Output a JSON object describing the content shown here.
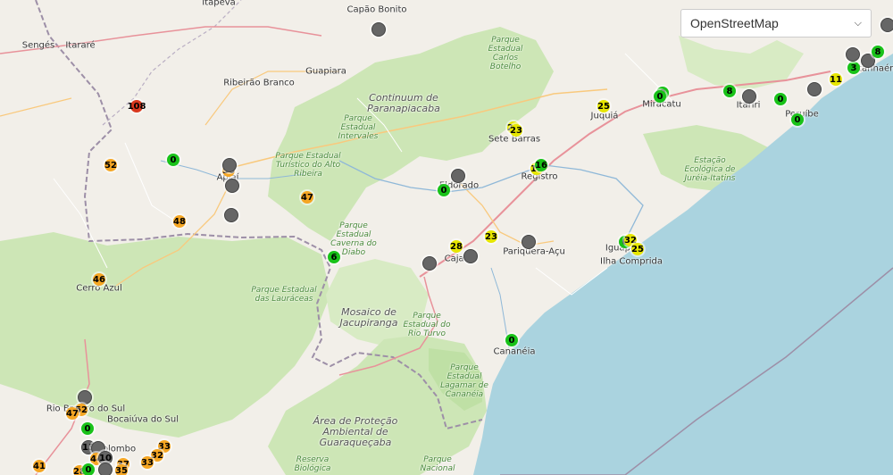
{
  "colors": {
    "green": "#19c219",
    "yellow": "#e6e600",
    "orange": "#f5a623",
    "red": "#d9381e",
    "gray": "#666666",
    "sea": "#aad3df",
    "forest": "#cde6b6"
  },
  "layer_select": {
    "value": "OpenStreetMap"
  },
  "places": [
    {
      "id": "itapeva",
      "label": "Itapeva"
    },
    {
      "id": "capao-bonito",
      "label": "Capão Bonito"
    },
    {
      "id": "senges",
      "label": "Sengés"
    },
    {
      "id": "itarare",
      "label": "Itararé"
    },
    {
      "id": "guapiara",
      "label": "Guapiara"
    },
    {
      "id": "ribeirao-branco",
      "label": "Ribeirão Branco"
    },
    {
      "id": "juquia",
      "label": "Juquiá"
    },
    {
      "id": "miracatu",
      "label": "Miracatu"
    },
    {
      "id": "itariri",
      "label": "Itariri"
    },
    {
      "id": "peruibe",
      "label": "Peruíbe"
    },
    {
      "id": "itanhaem",
      "label": "Itanhaém"
    },
    {
      "id": "sete-barras",
      "label": "Sete Barras"
    },
    {
      "id": "registro",
      "label": "Registro"
    },
    {
      "id": "eldorado",
      "label": "Eldorado"
    },
    {
      "id": "apiai",
      "label": "Apiaí"
    },
    {
      "id": "cajati",
      "label": "Cajati"
    },
    {
      "id": "pariquera-acu",
      "label": "Pariquera-Açu"
    },
    {
      "id": "iguape",
      "label": "Iguape"
    },
    {
      "id": "ilha-comprida",
      "label": "Ilha Comprida"
    },
    {
      "id": "cananeia",
      "label": "Cananéia"
    },
    {
      "id": "cerro-azul",
      "label": "Cerro Azul"
    },
    {
      "id": "rio-branco-do-sul",
      "label": "Rio Branco do Sul"
    },
    {
      "id": "bocaiuva-do-sul",
      "label": "Bocaiúva do Sul"
    },
    {
      "id": "colombo",
      "label": "Colombo"
    }
  ],
  "areas": [
    {
      "id": "parque-carlos-botelho",
      "label": "Parque Estadual Carlos Botelho"
    },
    {
      "id": "continuum",
      "label": "Continuum de Paranapiacaba"
    },
    {
      "id": "parque-intervales",
      "label": "Parque Estadual Intervales"
    },
    {
      "id": "parque-petar",
      "label": "Parque Estadual Turístico do Alto Ribeira"
    },
    {
      "id": "parque-caverna-do-diabo",
      "label": "Parque Estadual Caverna do Diabo"
    },
    {
      "id": "parque-lauraceas",
      "label": "Parque Estadual das Lauráceas"
    },
    {
      "id": "mosaico-jacupiranga",
      "label": "Mosaico de Jacupiranga"
    },
    {
      "id": "parque-rio-turvo",
      "label": "Parque Estadual do Rio Turvo"
    },
    {
      "id": "estacao-jureia",
      "label": "Estação Ecológica de Juréia-Itatins"
    },
    {
      "id": "parque-lagamar",
      "label": "Parque Estadual Lagamar de Cananéia"
    },
    {
      "id": "apa-guaraquecaba",
      "label": "Área de Proteção Ambiental de Guaraqueçaba"
    },
    {
      "id": "parque-nacional",
      "label": "Parque Nacional"
    },
    {
      "id": "reserva-biologica",
      "label": "Reserva Biológica"
    }
  ],
  "markers": [
    {
      "value": "",
      "color": "gray"
    },
    {
      "value": "108",
      "color": "red"
    },
    {
      "value": "52",
      "color": "orange"
    },
    {
      "value": "0",
      "color": "green"
    },
    {
      "value": "56",
      "color": "orange"
    },
    {
      "value": "",
      "color": "gray"
    },
    {
      "value": "",
      "color": "gray"
    },
    {
      "value": "47",
      "color": "orange"
    },
    {
      "value": "48",
      "color": "orange"
    },
    {
      "value": "",
      "color": "gray"
    },
    {
      "value": "6",
      "color": "green"
    },
    {
      "value": "46",
      "color": "orange"
    },
    {
      "value": "",
      "color": "gray"
    },
    {
      "value": "0",
      "color": "green"
    },
    {
      "value": "28",
      "color": "yellow"
    },
    {
      "value": "",
      "color": "gray"
    },
    {
      "value": "",
      "color": "gray"
    },
    {
      "value": "23",
      "color": "yellow"
    },
    {
      "value": "",
      "color": "gray"
    },
    {
      "value": "20",
      "color": "yellow"
    },
    {
      "value": "23",
      "color": "yellow"
    },
    {
      "value": "19",
      "color": "yellow"
    },
    {
      "value": "16",
      "color": "green"
    },
    {
      "value": "25",
      "color": "yellow"
    },
    {
      "value": "0",
      "color": "green"
    },
    {
      "value": "0",
      "color": "green"
    },
    {
      "value": "8",
      "color": "green"
    },
    {
      "value": "",
      "color": "gray"
    },
    {
      "value": "0",
      "color": "green"
    },
    {
      "value": "",
      "color": "gray"
    },
    {
      "value": "0",
      "color": "green"
    },
    {
      "value": "11",
      "color": "yellow"
    },
    {
      "value": "3",
      "color": "green"
    },
    {
      "value": "",
      "color": "gray"
    },
    {
      "value": "",
      "color": "gray"
    },
    {
      "value": "",
      "color": "gray"
    },
    {
      "value": "8",
      "color": "green"
    },
    {
      "value": "0",
      "color": "green"
    },
    {
      "value": "32",
      "color": "yellow"
    },
    {
      "value": "25",
      "color": "yellow"
    },
    {
      "value": "0",
      "color": "green"
    },
    {
      "value": "",
      "color": "gray"
    },
    {
      "value": "52",
      "color": "orange"
    },
    {
      "value": "47",
      "color": "orange"
    },
    {
      "value": "0",
      "color": "green"
    },
    {
      "value": "13",
      "color": "gray"
    },
    {
      "value": "",
      "color": "gray"
    },
    {
      "value": "44",
      "color": "orange"
    },
    {
      "value": "10",
      "color": "gray"
    },
    {
      "value": "33",
      "color": "orange"
    },
    {
      "value": "32",
      "color": "orange"
    },
    {
      "value": "33",
      "color": "orange"
    },
    {
      "value": "37",
      "color": "orange"
    },
    {
      "value": "41",
      "color": "orange"
    },
    {
      "value": "28",
      "color": "orange"
    },
    {
      "value": "0",
      "color": "green"
    },
    {
      "value": "",
      "color": "gray"
    },
    {
      "value": "35",
      "color": "orange"
    }
  ]
}
